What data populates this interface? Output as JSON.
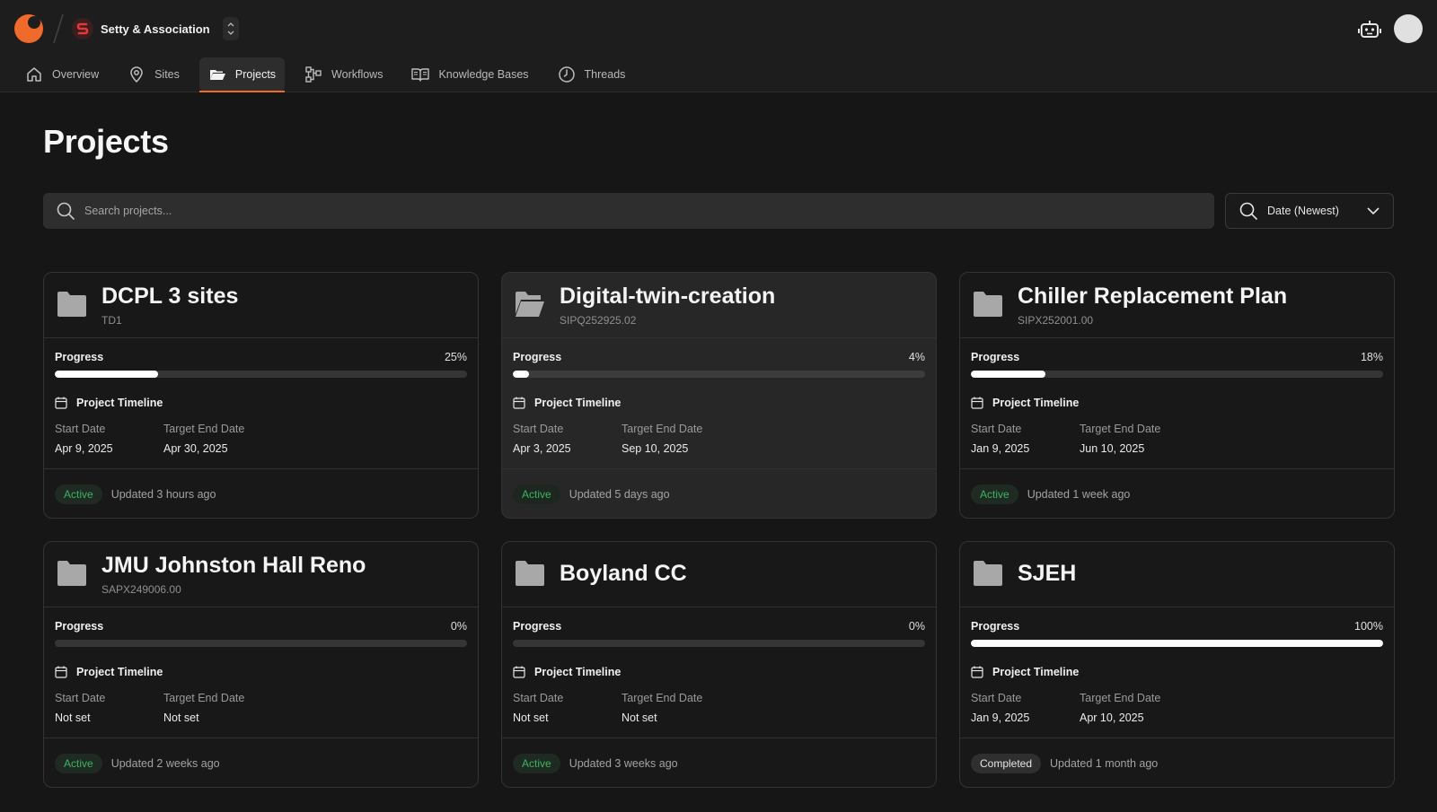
{
  "header": {
    "org_name": "Setty & Association",
    "org_initial": "S"
  },
  "nav": [
    {
      "label": "Overview",
      "icon": "home-icon"
    },
    {
      "label": "Sites",
      "icon": "map-pin-icon"
    },
    {
      "label": "Projects",
      "icon": "folder-open-icon",
      "active": true
    },
    {
      "label": "Workflows",
      "icon": "workflow-icon"
    },
    {
      "label": "Knowledge Bases",
      "icon": "book-icon"
    },
    {
      "label": "Threads",
      "icon": "clock-icon"
    }
  ],
  "page": {
    "title": "Projects",
    "search_placeholder": "Search projects...",
    "sort_label": "Date (Newest)"
  },
  "labels": {
    "progress": "Progress",
    "timeline": "Project Timeline",
    "start": "Start Date",
    "end": "Target End Date"
  },
  "colors": {
    "accent": "#f06a2b",
    "active_badge": "#3bb55f"
  },
  "projects": [
    {
      "title": "DCPL 3 sites",
      "code": "TD1",
      "progress_pct": 25,
      "progress_text": "25%",
      "start": "Apr 9, 2025",
      "end": "Apr 30, 2025",
      "status": "Active",
      "updated": "Updated 3 hours ago"
    },
    {
      "title": "Digital-twin-creation",
      "code": "SIPQ252925.02",
      "progress_pct": 4,
      "progress_text": "4%",
      "start": "Apr 3, 2025",
      "end": "Sep 10, 2025",
      "status": "Active",
      "updated": "Updated 5 days ago"
    },
    {
      "title": "Chiller Replacement Plan",
      "code": "SIPX252001.00",
      "progress_pct": 18,
      "progress_text": "18%",
      "start": "Jan 9, 2025",
      "end": "Jun 10, 2025",
      "status": "Active",
      "updated": "Updated 1 week ago"
    },
    {
      "title": "JMU Johnston Hall Reno",
      "code": "SAPX249006.00",
      "progress_pct": 0,
      "progress_text": "0%",
      "start": "Not set",
      "end": "Not set",
      "status": "Active",
      "updated": "Updated 2 weeks ago"
    },
    {
      "title": "Boyland CC",
      "code": "",
      "progress_pct": 0,
      "progress_text": "0%",
      "start": "Not set",
      "end": "Not set",
      "status": "Active",
      "updated": "Updated 3 weeks ago"
    },
    {
      "title": "SJEH",
      "code": "",
      "progress_pct": 100,
      "progress_text": "100%",
      "start": "Jan 9, 2025",
      "end": "Apr 10, 2025",
      "status": "Completed",
      "updated": "Updated 1 month ago"
    }
  ]
}
